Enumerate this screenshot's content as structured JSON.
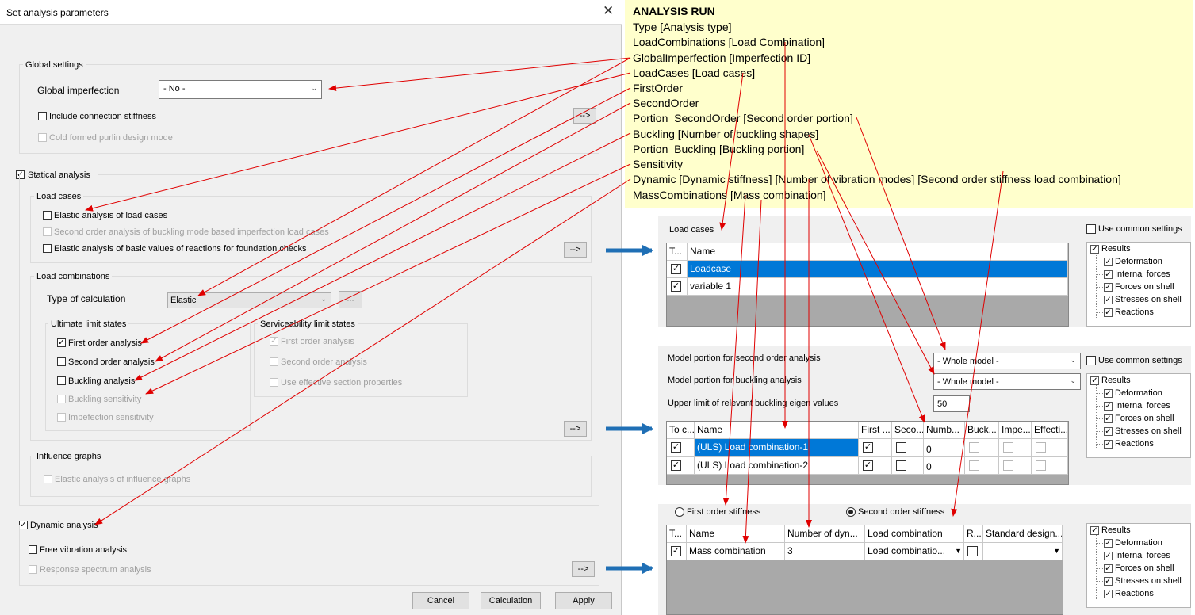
{
  "dialog": {
    "title": "Set analysis parameters",
    "global_settings": {
      "title": "Global settings",
      "global_imperfection_label": "Global imperfection",
      "global_imperfection_value": "- No -",
      "include_connection_stiffness": "Include connection stiffness",
      "cold_formed": "Cold formed purlin design mode",
      "arrow_button": "-->"
    },
    "statical_analysis": "Statical analysis",
    "load_cases": {
      "title": "Load cases",
      "elastic": "Elastic analysis of load cases",
      "second_order_buckling": "Second order analysis of buckling mode based imperfection load cases",
      "elastic_basic": "Elastic analysis of basic values of reactions for foundation checks",
      "arrow_button": "-->"
    },
    "load_combinations": {
      "title": "Load combinations",
      "type_label": "Type of calculation",
      "type_value": "Elastic",
      "more_button": "...",
      "uls_title": "Ultimate limit states",
      "uls_items": [
        "First order analysis",
        "Second order analysis",
        "Buckling analysis",
        "Buckling sensitivity",
        "Impefection sensitivity"
      ],
      "sls_title": "Serviceability limit states",
      "sls_items": [
        "First order analysis",
        "Second order analysis",
        "Use effective section properties"
      ],
      "arrow_button": "-->"
    },
    "influence_graphs": {
      "title": "Influence graphs",
      "elastic": "Elastic analysis of influence graphs"
    },
    "dynamic_analysis": {
      "title": "Dynamic analysis",
      "free_vibration": "Free vibration analysis",
      "response_spectrum": "Response spectrum analysis",
      "arrow_button": "-->"
    },
    "buttons": {
      "cancel": "Cancel",
      "calculation": "Calculation",
      "apply": "Apply"
    }
  },
  "note": {
    "title": "ANALYSIS RUN",
    "lines": [
      "Type [Analysis type]",
      "LoadCombinations [Load Combination]",
      "GlobalImperfection [Imperfection ID]",
      "LoadCases [Load cases]",
      "FirstOrder",
      "SecondOrder",
      "Portion_SecondOrder [Second order portion]",
      "Buckling [Number of buckling shapes]",
      "Portion_Buckling [Buckling portion]",
      "Sensitivity",
      "Dynamic [Dynamic stiffness] [Number of vibration modes] [Second order stiffness load combination]",
      "MassCombinations [Mass combination]"
    ]
  },
  "panel1": {
    "title": "Load cases",
    "use_common": "Use common settings",
    "headers": [
      "T...",
      "Name"
    ],
    "rows": [
      "Loadcase",
      "variable 1"
    ]
  },
  "panel2": {
    "second_order_label": "Model portion for second order analysis",
    "second_order_value": "- Whole model -",
    "buckling_label": "Model portion for buckling analysis",
    "buckling_value": "- Whole model -",
    "upper_limit_label": "Upper limit of relevant buckling eigen values",
    "upper_limit_value": "50",
    "use_common": "Use common settings",
    "headers": [
      "To c...",
      "Name",
      "First ...",
      "Seco...",
      "Numb...",
      "Buck...",
      "Impe...",
      "Effecti..."
    ],
    "rows": [
      {
        "name": "(ULS) Load combination-1",
        "number": "0"
      },
      {
        "name": "(ULS) Load combination-2",
        "number": "0"
      }
    ]
  },
  "panel3": {
    "first_order": "First order stiffness",
    "second_order": "Second order stiffness",
    "headers": [
      "T...",
      "Name",
      "Number of dyn...",
      "Load combination",
      "R...",
      "Standard design..."
    ],
    "row": {
      "name": "Mass combination",
      "number": "3",
      "load_combination": "Load combinatio..."
    }
  },
  "results": [
    "Results",
    "Deformation",
    "Internal forces",
    "Forces on shell",
    "Stresses on shell",
    "Reactions"
  ],
  "colors": {
    "selection": "#0078d7",
    "note_bg": "#ffffcc",
    "callout_arrow": "#e00000",
    "flow_arrow": "#1f6fb5"
  }
}
